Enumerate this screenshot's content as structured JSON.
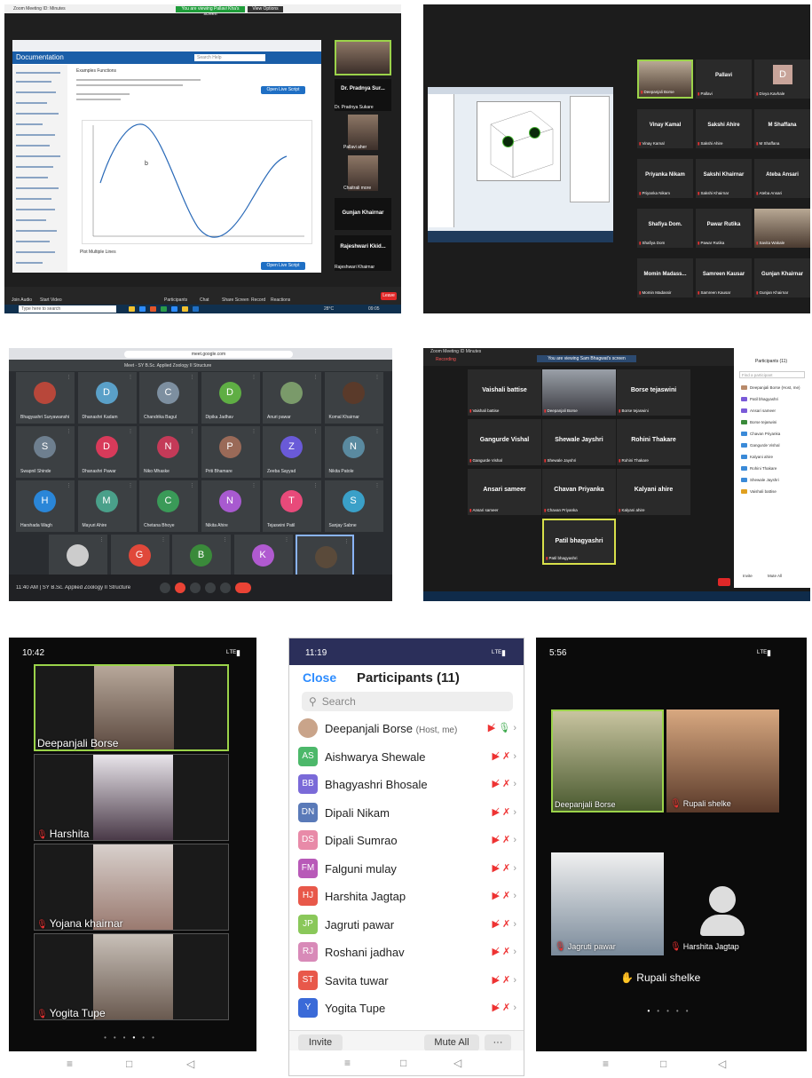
{
  "panel1": {
    "window_title": "Zoom Meeting ID: Minutes",
    "share_banner": "You are viewing Pallavi Kha's screen",
    "view_options": "View Options",
    "doc_title": "Documentation",
    "search_placeholder": "Search Help",
    "doc_tab": "Examples  Functions",
    "example_button": "Open Live Script",
    "section_label": "Plot Multiple Lines",
    "example_button_2": "Open Live Script",
    "participants": [
      {
        "label": "Dr. Pradnya Sur...",
        "sub": "Dr. Pradnya Sukare"
      },
      {
        "label": "",
        "sub": "Pallavi aher"
      },
      {
        "label": "",
        "sub": "Chaitrali more"
      },
      {
        "label": "Gunjan Khairnar",
        "sub": ""
      },
      {
        "label": "Rajeshwari Kkid...",
        "sub": "Rajeshwari Khairnar"
      }
    ],
    "controls": [
      "Join Audio",
      "Start Video",
      "Participants",
      "Chat",
      "Share Screen",
      "Record",
      "Reactions"
    ],
    "end_label": "Leave",
    "taskbar_search": "Type here to search",
    "weather": "28°C",
    "time": "09:05"
  },
  "panel2": {
    "tiles": [
      {
        "name": "",
        "label": "Deepanjali Borse",
        "face": true
      },
      {
        "name": "Pallavi",
        "label": "Pallavi"
      },
      {
        "name": "D",
        "label": "Divya Kavhale",
        "avatar": true
      },
      {
        "name": "Vinay Kamal",
        "label": "Vinay Kamal"
      },
      {
        "name": "Sakshi Ahire",
        "label": "Sakshi Ahire"
      },
      {
        "name": "M Shaffana",
        "label": "M Shaffana"
      },
      {
        "name": "Priyanka Nikam",
        "label": "Priyanka Nikam"
      },
      {
        "name": "Sakshi Khairnar",
        "label": "Sakshi Khairnar"
      },
      {
        "name": "Ateba Ansari",
        "label": "Ateba Ansari"
      },
      {
        "name": "Shafiya Dom.",
        "label": "Shafiya Dom"
      },
      {
        "name": "Pawar Rutika",
        "label": "Pawar Rutika"
      },
      {
        "name": "",
        "label": "Savita Wakale",
        "face": true
      },
      {
        "name": "Momin Madass...",
        "label": "Momin Madassir"
      },
      {
        "name": "Samreen Kausar",
        "label": "Samreen Kausar"
      },
      {
        "name": "Gunjan Khairnar",
        "label": "Gunjan Khairnar"
      }
    ]
  },
  "panel3": {
    "url": "meet.google.com",
    "tab": "Meet - SY B.Sc. Applied Zoology II Structure",
    "tiles": [
      {
        "init": "",
        "label": "Bhagyashri Suryawanshi",
        "color": "#b8473a",
        "photo": true
      },
      {
        "init": "D",
        "label": "Dhanashri Kadam",
        "color": "#5aa0c8"
      },
      {
        "init": "C",
        "label": "Chandrika Bagul",
        "color": "#7d8fa0"
      },
      {
        "init": "D",
        "label": "Dipika Jadhav",
        "color": "#5fae44"
      },
      {
        "init": "",
        "label": "Anuri pawar",
        "color": "#7a9a6a",
        "photo": true
      },
      {
        "init": "",
        "label": "Komal Khairnar",
        "color": "#5a3a2a",
        "photo": true
      },
      {
        "init": "S",
        "label": "Swapnil Shinde",
        "color": "#6e7f8f"
      },
      {
        "init": "D",
        "label": "Dhanashri Pawar",
        "color": "#d83a5a"
      },
      {
        "init": "N",
        "label": "Niko Mhaske",
        "color": "#c43a58"
      },
      {
        "init": "P",
        "label": "Priti Bhamare",
        "color": "#9a6a58"
      },
      {
        "init": "Z",
        "label": "Zeeba Sayyad",
        "color": "#6a5ad8"
      },
      {
        "init": "N",
        "label": "Nikita Patole",
        "color": "#5a8aa0"
      },
      {
        "init": "H",
        "label": "Harshada Wagh",
        "color": "#2a86d8"
      },
      {
        "init": "M",
        "label": "Mayuri Ahire",
        "color": "#4aa08a"
      },
      {
        "init": "C",
        "label": "Chetana Bhoye",
        "color": "#3a9a58"
      },
      {
        "init": "N",
        "label": "Nikita Ahire",
        "color": "#a85ad0"
      },
      {
        "init": "T",
        "label": "Tejaswini Patil",
        "color": "#e84a7a"
      },
      {
        "init": "S",
        "label": "Sanjay Sabne",
        "color": "#3aa0c8"
      },
      {
        "init": "",
        "label": "Tanuja Kale",
        "color": "#cccccc",
        "photo": true
      },
      {
        "init": "G",
        "label": "Gayatri Dhivare",
        "color": "#e0483a"
      },
      {
        "init": "B",
        "label": "Bhushan Khairnar",
        "color": "#3a8a3a"
      },
      {
        "init": "K",
        "label": "Ketan Tonde",
        "color": "#b05ad0"
      },
      {
        "init": "",
        "label": "You",
        "color": "#5a4a3a",
        "photo": true
      }
    ],
    "meeting_info": "11:40 AM  |  SY B.Sc. Applied Zoology II Structure"
  },
  "panel4": {
    "title": "Zoom Meeting ID Minutes",
    "recording": "Recording",
    "banner": "You are viewing Sam Bhagwat's screen",
    "tiles": [
      {
        "name": "Vaishali battise",
        "label": "Vaishali battise"
      },
      {
        "name": "",
        "label": "Deepanjali Borse",
        "face": true
      },
      {
        "name": "Borse tejaswini",
        "label": "Borse tejaswini"
      },
      {
        "name": "Gangurde Vishal",
        "label": "Gangurde Vishal"
      },
      {
        "name": "Shewale Jayshri",
        "label": "Shewale Jayshri"
      },
      {
        "name": "Rohini Thakare",
        "label": "Rohini Thakare"
      },
      {
        "name": "Ansari sameer",
        "label": "Ansari sameer"
      },
      {
        "name": "Chavan Priyanka",
        "label": "Chavan Priyanka"
      },
      {
        "name": "Kalyani ahire",
        "label": "Kalyani ahire"
      },
      {
        "name": "Patil bhagyashri",
        "label": "Patil bhagyashri",
        "sel": true
      }
    ],
    "list_title": "Participants (11)",
    "list_search": "Find a participant",
    "list_items": [
      {
        "name": "Deepanjali Borse (Host, me)",
        "color": "#b88a6a"
      },
      {
        "name": "Patil bhagyashri",
        "color": "#7a5ad8"
      },
      {
        "name": "Ansari sameer",
        "color": "#7a5ad8"
      },
      {
        "name": "Borse tejaswini",
        "color": "#3a8a3a"
      },
      {
        "name": "Chavan Priyanka",
        "color": "#3a8ad8"
      },
      {
        "name": "Gangurde Vishal",
        "color": "#3a8ad8"
      },
      {
        "name": "Kalyani ahire",
        "color": "#3a8ad8"
      },
      {
        "name": "Rohini Thakare",
        "color": "#3a8ad8"
      },
      {
        "name": "Shewale Jayshri",
        "color": "#3a8ad8"
      },
      {
        "name": "Vaishali battise",
        "color": "#e0a020"
      }
    ],
    "list_buttons": [
      "Invite",
      "Mute All"
    ]
  },
  "phone1": {
    "time": "10:42",
    "signal": "ᴸᵀᴱ .ıl",
    "videos": [
      "Deepanjali Borse",
      "Harshita",
      "Yojana khairnar",
      "Yogita Tupe"
    ]
  },
  "phone2": {
    "time": "11:19",
    "close": "Close",
    "title": "Participants (11)",
    "search": "Search",
    "rows": [
      {
        "init": "",
        "name": "Deepanjali Borse",
        "tag": "(Host, me)",
        "color": "#c9a48a",
        "photo": true
      },
      {
        "init": "AS",
        "name": "Aishwarya Shewale",
        "color": "#4cb86a"
      },
      {
        "init": "BB",
        "name": "Bhagyashri Bhosale",
        "color": "#7a6ad8"
      },
      {
        "init": "DN",
        "name": "Dipali Nikam",
        "color": "#5a7ab8"
      },
      {
        "init": "DS",
        "name": "Dipali Sumrao",
        "color": "#e88aa8"
      },
      {
        "init": "FM",
        "name": "Falguni mulay",
        "color": "#b85ab8"
      },
      {
        "init": "HJ",
        "name": "Harshita Jagtap",
        "color": "#e8584a"
      },
      {
        "init": "JP",
        "name": "Jagruti pawar",
        "color": "#8ac85a"
      },
      {
        "init": "RJ",
        "name": "Roshani jadhav",
        "color": "#d88ab8"
      },
      {
        "init": "ST",
        "name": "Savita tuwar",
        "color": "#e8584a"
      },
      {
        "init": "Y",
        "name": "Yogita Tupe",
        "color": "#3a6ad8"
      }
    ],
    "invite": "Invite",
    "mute_all": "Mute All",
    "more": "···"
  },
  "phone3": {
    "time": "5:56",
    "videos": [
      "Deepanjali Borse",
      "Rupali shelke",
      "Jagruti pawar",
      "Harshita Jagtap"
    ],
    "raised": "Rupali shelke"
  }
}
